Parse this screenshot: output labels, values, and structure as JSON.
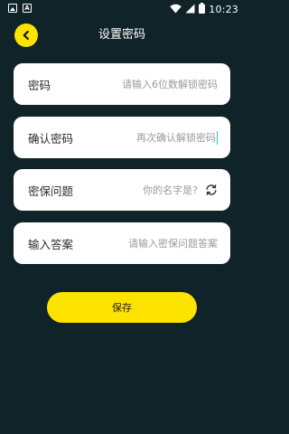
{
  "status_bar": {
    "time": "10:23",
    "left_icons": [
      "image-icon",
      "font-icon"
    ],
    "letter_glyph": "A",
    "right_icons": [
      "wifi-icon",
      "signal-icon",
      "battery-icon"
    ]
  },
  "header": {
    "title": "设置密码",
    "back_icon": "chevron-left-icon"
  },
  "form": {
    "password": {
      "label": "密码",
      "placeholder": "请输入6位数解锁密码",
      "value": ""
    },
    "confirm_password": {
      "label": "确认密码",
      "placeholder": "再次确认解锁密码",
      "value": ""
    },
    "security_question": {
      "label": "密保问题",
      "placeholder": "你的名字是?",
      "value": "",
      "action_icon": "refresh-icon"
    },
    "answer": {
      "label": "输入答案",
      "placeholder": "请输入密保问题答案",
      "value": ""
    }
  },
  "save_button": {
    "label": "保存"
  },
  "colors": {
    "background": "#0f2329",
    "accent": "#fce300",
    "field_bg": "#ffffff",
    "placeholder": "#9a9a9a",
    "caret": "#1fc7c7"
  }
}
